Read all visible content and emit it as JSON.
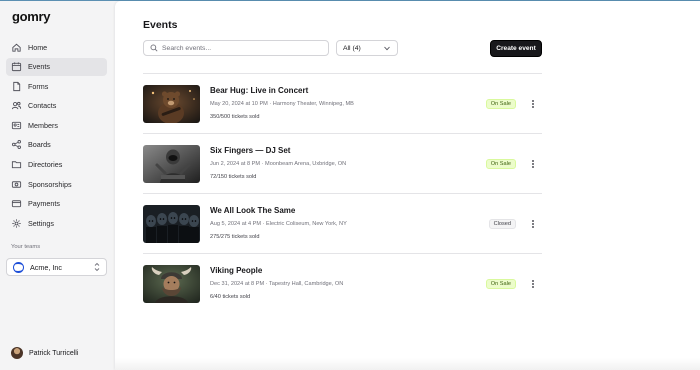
{
  "app": {
    "logo": "gomry"
  },
  "sidebar": {
    "items": [
      {
        "label": "Home",
        "icon": "home-icon"
      },
      {
        "label": "Events",
        "icon": "calendar-icon"
      },
      {
        "label": "Forms",
        "icon": "forms-icon"
      },
      {
        "label": "Contacts",
        "icon": "contacts-icon"
      },
      {
        "label": "Members",
        "icon": "members-icon"
      },
      {
        "label": "Boards",
        "icon": "share-icon"
      },
      {
        "label": "Directories",
        "icon": "directories-icon"
      },
      {
        "label": "Sponsorships",
        "icon": "sponsorship-icon"
      },
      {
        "label": "Payments",
        "icon": "payments-icon"
      },
      {
        "label": "Settings",
        "icon": "gear-icon"
      }
    ],
    "active": "Events",
    "teams_label": "Your teams",
    "team": "Acme, Inc",
    "user": "Patrick Turricelli"
  },
  "main": {
    "title": "Events",
    "search_placeholder": "Search events...",
    "filter": "All (4)",
    "create_button": "Create event",
    "events": [
      {
        "name": "Bear Hug: Live in Concert",
        "meta": "May 20, 2024 at 10 PM · Harmony Theater, Winnipeg, MB",
        "sold": "350/500 tickets sold",
        "status": "On Sale"
      },
      {
        "name": "Six Fingers — DJ Set",
        "meta": "Jun 2, 2024 at 8 PM · Moonbeam Arena, Uxbridge, ON",
        "sold": "72/150 tickets sold",
        "status": "On Sale"
      },
      {
        "name": "We All Look The Same",
        "meta": "Aug 5, 2024 at 4 PM · Electric Coliseum, New York, NY",
        "sold": "275/275 tickets sold",
        "status": "Closed"
      },
      {
        "name": "Viking People",
        "meta": "Dec 31, 2024 at 8 PM · Tapestry Hall, Cambridge, ON",
        "sold": "6/40 tickets sold",
        "status": "On Sale"
      }
    ]
  },
  "colors": {
    "on_sale_bg": "#ecfccb",
    "on_sale_text": "#3f6212",
    "primary": "#18181b"
  }
}
